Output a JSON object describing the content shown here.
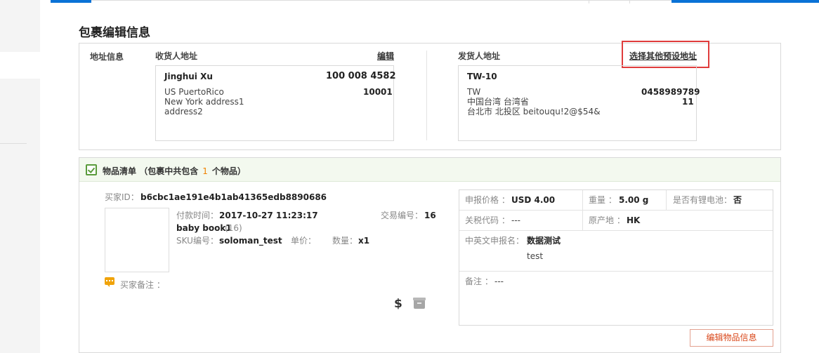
{
  "colors": {
    "accent": "#0a72d6",
    "brand_red": "#e03c3c",
    "count_orange": "#f08200",
    "items_header_bg": "#f3f9ef"
  },
  "page": {
    "title": "包裹编辑信息"
  },
  "address": {
    "section_label": "地址信息",
    "recipient": {
      "title": "收货人地址",
      "edit_label": "编辑",
      "name": "Jinghui Xu",
      "phone": "100 008 4582",
      "line1": "US PuertoRico",
      "zip": "10001",
      "line2": "New York address1",
      "line3": "address2"
    },
    "sender": {
      "title": "发货人地址",
      "choose_label": "选择其他预设地址",
      "name": "TW-10",
      "line1": "TW",
      "phone": "0458989789",
      "line2": "中国台湾 台湾省",
      "num": "11",
      "line3": "台北市 北投区 beitouqu!2@$54&"
    }
  },
  "items": {
    "header_title": "物品清单",
    "header_prefix": "（包裹中共包含",
    "count": "1",
    "header_suffix": "个物品）",
    "buyer_id_label": "买家ID：",
    "buyer_id": "b6cbc1ae191e4b1ab41365edb8890686",
    "pay_time_label": "付款时间：",
    "pay_time": "2017-10-27 11:23:17",
    "trade_no_label": "交易编号：",
    "trade_no": "16",
    "product_name": "baby book1",
    "product_qty_paren": "(16)",
    "sku_label": "SKU编号：",
    "sku": "soloman_test",
    "unit_price_label": "单价：",
    "quantity_label": "数量：",
    "quantity": "x1",
    "buyer_note_label": "买家备注 ："
  },
  "declaration": {
    "declared_value_label": "申报价格 ：",
    "declared_value": "USD 4.00",
    "weight_label": "重量 ：",
    "weight": "5.00 g",
    "lithium_label": "是否有锂电池：",
    "lithium": "否",
    "hs_code_label": "关税代码 ：",
    "hs_code": "---",
    "origin_label": "原产地 ：",
    "origin": "HK",
    "declared_name_label": "中英文申报名：",
    "declared_name_cn": "数据测试",
    "declared_name_en": "test",
    "remark_label": "备注 ：",
    "remark": "---"
  },
  "buttons": {
    "edit_item": "编辑物品信息"
  },
  "icons": {
    "currency": "$",
    "items": "checkbox-icon",
    "note": "comment-icon",
    "box": "package-icon"
  }
}
